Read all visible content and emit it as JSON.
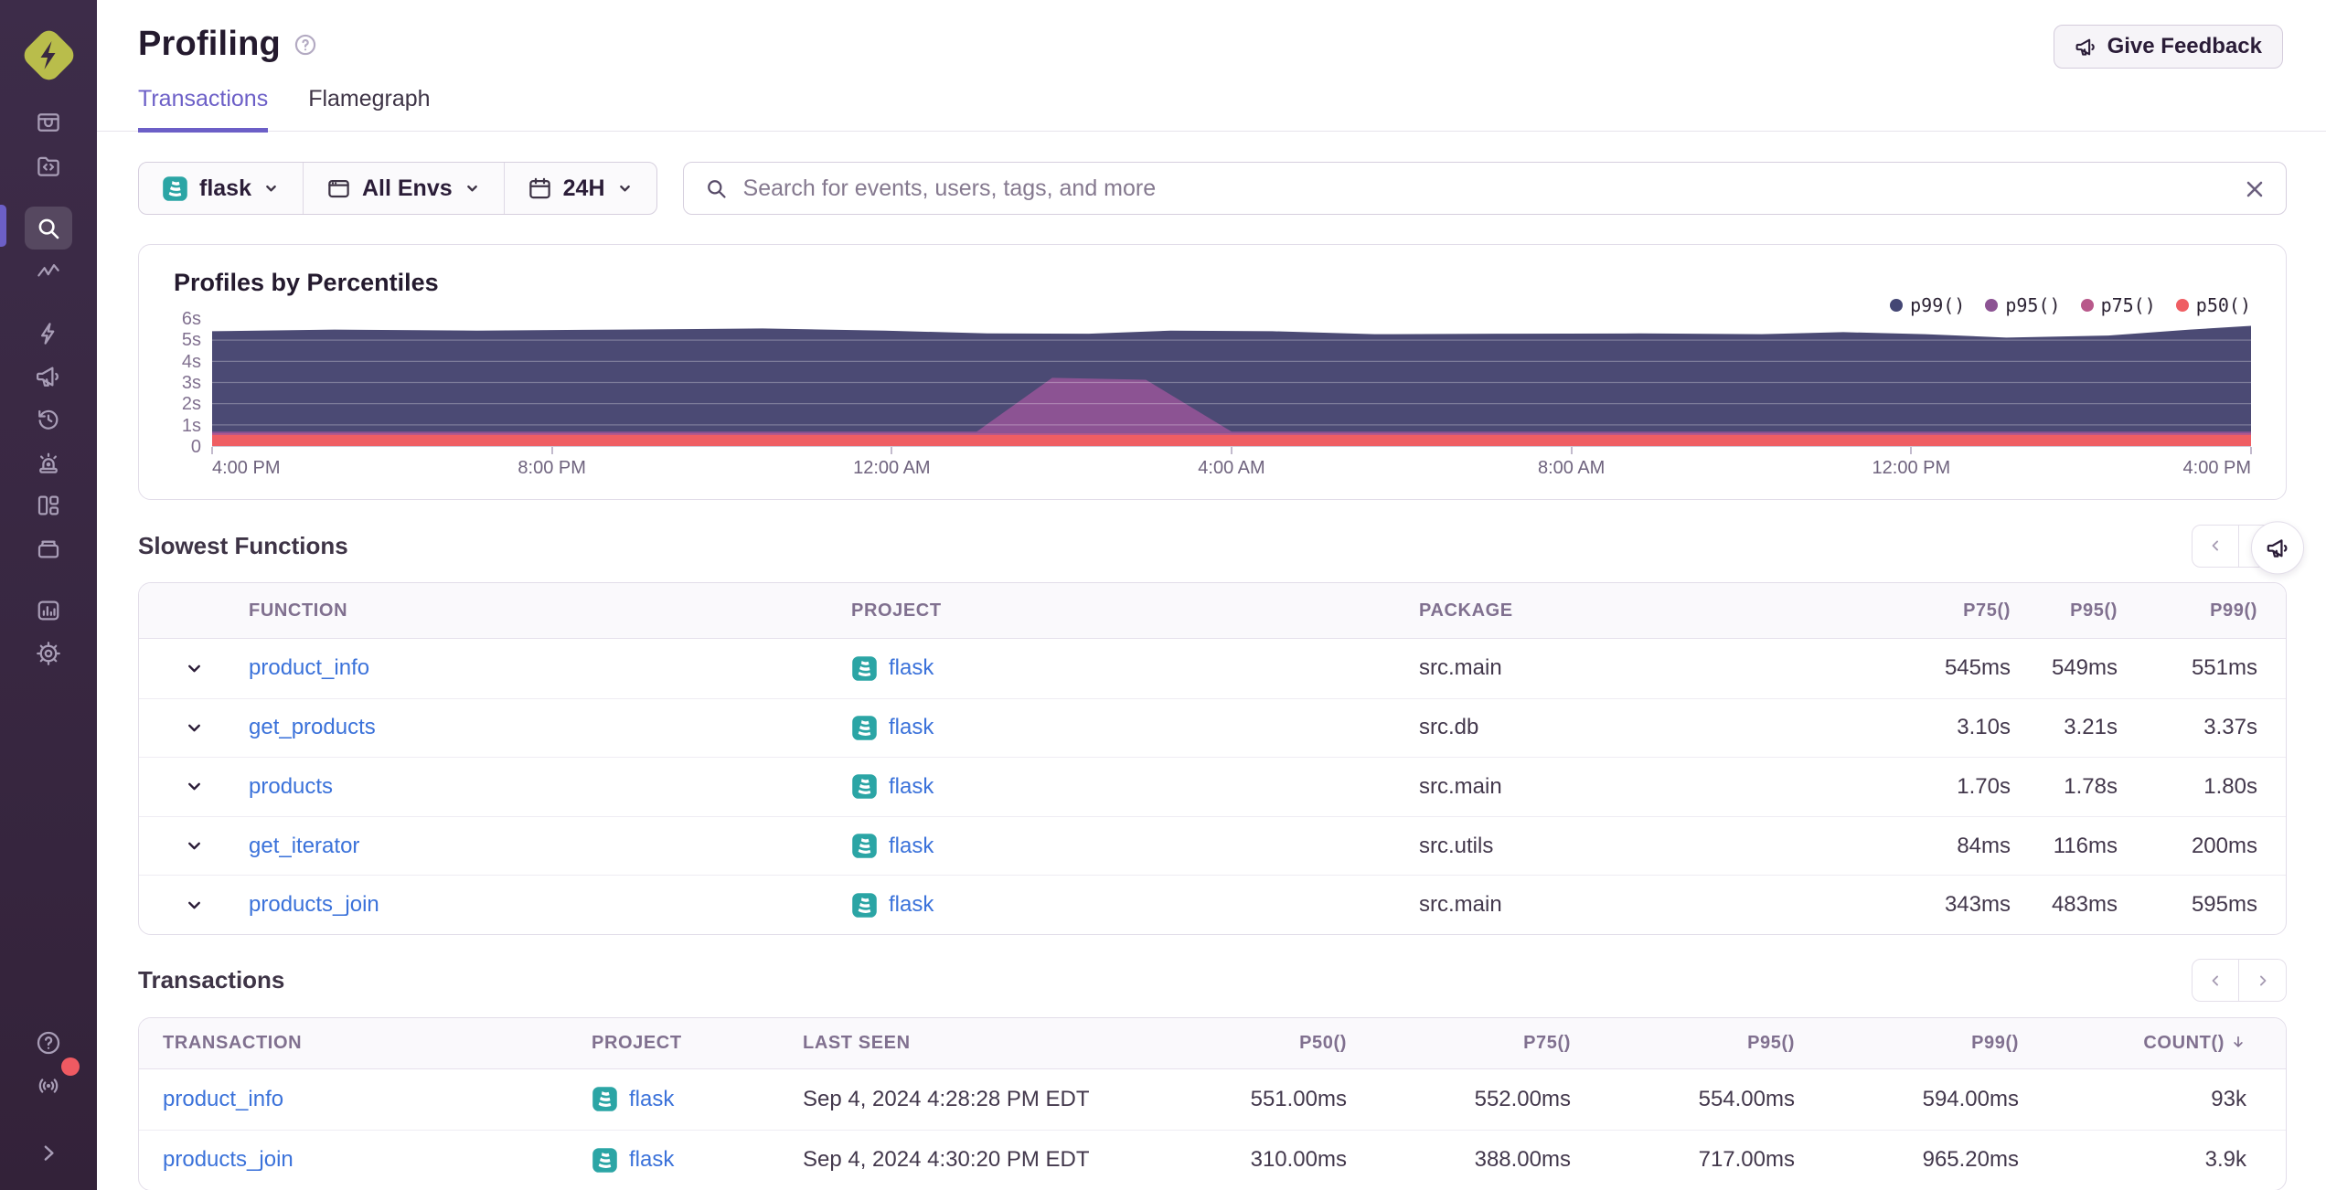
{
  "app": {
    "give_feedback_label": "Give Feedback"
  },
  "header": {
    "title": "Profiling"
  },
  "tabs": [
    {
      "label": "Transactions",
      "active": true
    },
    {
      "label": "Flamegraph",
      "active": false
    }
  ],
  "filters": {
    "project_label": "flask",
    "env_label": "All Envs",
    "period_label": "24H",
    "search_placeholder": "Search for events, users, tags, and more"
  },
  "chart_data": {
    "type": "area",
    "title": "Profiles by Percentiles",
    "unit": "seconds",
    "ylim": [
      0,
      6
    ],
    "y_ticks": [
      "0",
      "1s",
      "2s",
      "3s",
      "4s",
      "5s",
      "6s"
    ],
    "x_ticks": [
      "4:00 PM",
      "8:00 PM",
      "12:00 AM",
      "4:00 AM",
      "8:00 AM",
      "12:00 PM",
      "4:00 PM"
    ],
    "grid": true,
    "legend_position": "top-right",
    "legend": [
      {
        "name": "p99()",
        "color": "#444674"
      },
      {
        "name": "p95()",
        "color": "#8c5393"
      },
      {
        "name": "p75()",
        "color": "#b8588a"
      },
      {
        "name": "p50()",
        "color": "#ef5e63"
      }
    ],
    "series": [
      {
        "name": "p99()",
        "color": "#4b4a74",
        "points": [
          [
            0,
            5.42
          ],
          [
            0.06,
            5.5
          ],
          [
            0.13,
            5.45
          ],
          [
            0.2,
            5.5
          ],
          [
            0.27,
            5.55
          ],
          [
            0.33,
            5.45
          ],
          [
            0.38,
            5.32
          ],
          [
            0.43,
            5.3
          ],
          [
            0.47,
            5.45
          ],
          [
            0.52,
            5.42
          ],
          [
            0.57,
            5.28
          ],
          [
            0.63,
            5.3
          ],
          [
            0.7,
            5.32
          ],
          [
            0.76,
            5.28
          ],
          [
            0.8,
            5.38
          ],
          [
            0.84,
            5.28
          ],
          [
            0.88,
            5.12
          ],
          [
            0.93,
            5.22
          ],
          [
            0.97,
            5.5
          ],
          [
            1,
            5.68
          ]
        ]
      },
      {
        "name": "p95()",
        "color": "#8c5393",
        "points": [
          [
            0,
            0.68
          ],
          [
            0.375,
            0.68
          ],
          [
            0.412,
            3.22
          ],
          [
            0.458,
            3.13
          ],
          [
            0.5,
            0.68
          ],
          [
            1,
            0.68
          ]
        ]
      },
      {
        "name": "p75()",
        "color": "#b8588a",
        "points": [
          [
            0,
            0.6
          ],
          [
            1,
            0.6
          ]
        ]
      },
      {
        "name": "p50()",
        "color": "#ef5e63",
        "points": [
          [
            0,
            0.52
          ],
          [
            1,
            0.52
          ]
        ]
      }
    ]
  },
  "slowest_functions": {
    "title": "Slowest Functions",
    "columns": [
      "FUNCTION",
      "PROJECT",
      "PACKAGE",
      "P75()",
      "P95()",
      "P99()"
    ],
    "rows": [
      {
        "function": "product_info",
        "project": "flask",
        "package": "src.main",
        "p75": "545ms",
        "p95": "549ms",
        "p99": "551ms"
      },
      {
        "function": "get_products",
        "project": "flask",
        "package": "src.db",
        "p75": "3.10s",
        "p95": "3.21s",
        "p99": "3.37s"
      },
      {
        "function": "products",
        "project": "flask",
        "package": "src.main",
        "p75": "1.70s",
        "p95": "1.78s",
        "p99": "1.80s"
      },
      {
        "function": "get_iterator",
        "project": "flask",
        "package": "src.utils",
        "p75": "84ms",
        "p95": "116ms",
        "p99": "200ms"
      },
      {
        "function": "products_join",
        "project": "flask",
        "package": "src.main",
        "p75": "343ms",
        "p95": "483ms",
        "p99": "595ms"
      }
    ]
  },
  "transactions": {
    "title": "Transactions",
    "columns": [
      "TRANSACTION",
      "PROJECT",
      "LAST SEEN",
      "P50()",
      "P75()",
      "P95()",
      "P99()",
      "COUNT()"
    ],
    "sort": {
      "column": "COUNT()",
      "direction": "desc"
    },
    "rows": [
      {
        "transaction": "product_info",
        "project": "flask",
        "last_seen": "Sep 4, 2024 4:28:28 PM EDT",
        "p50": "551.00ms",
        "p75": "552.00ms",
        "p95": "554.00ms",
        "p99": "594.00ms",
        "count": "93k"
      },
      {
        "transaction": "products_join",
        "project": "flask",
        "last_seen": "Sep 4, 2024 4:30:20 PM EDT",
        "p50": "310.00ms",
        "p75": "388.00ms",
        "p95": "717.00ms",
        "p99": "965.20ms",
        "count": "3.9k"
      }
    ]
  },
  "colors": {
    "accent_purple": "#6c5fc7",
    "link_blue": "#3b72da",
    "project_badge_teal": "#2ba5a5",
    "sidebar_bg": "#382741",
    "notification_red": "#ef5a62"
  }
}
